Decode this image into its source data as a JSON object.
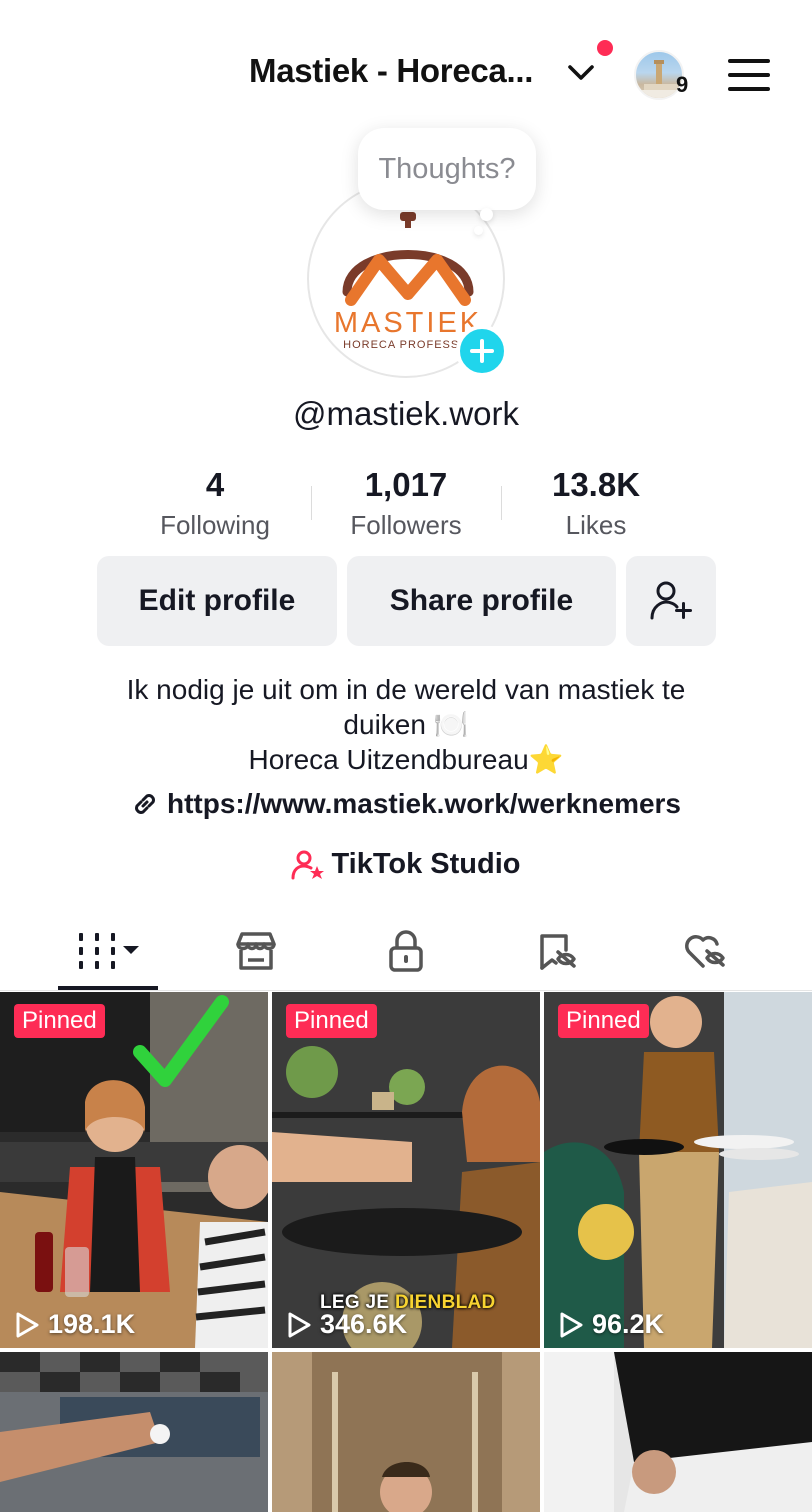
{
  "header": {
    "account_name": "Mastiek - Horeca...",
    "switch_account_count": "9"
  },
  "profile": {
    "thoughts_placeholder": "Thoughts?",
    "logo": {
      "brand": "MASTIEK",
      "tagline": "HORECA PROFESSIO"
    },
    "username": "@mastiek.work"
  },
  "stats": [
    {
      "value": "4",
      "label": "Following"
    },
    {
      "value": "1,017",
      "label": "Followers"
    },
    {
      "value": "13.8K",
      "label": "Likes"
    }
  ],
  "actions": {
    "edit_profile": "Edit profile",
    "share_profile": "Share profile"
  },
  "bio": {
    "line1": "Ik nodig je uit om in de wereld van mastiek te",
    "line2": "duiken 🍽️",
    "line3": "Horeca Uitzendbureau⭐",
    "link": "https://www.mastiek.work/werknemers",
    "studio": "TikTok Studio"
  },
  "tabs": [
    {
      "name": "videos",
      "icon": "grid-bars-icon",
      "active": true
    },
    {
      "name": "shop",
      "icon": "storefront-icon",
      "active": false
    },
    {
      "name": "private",
      "icon": "lock-icon",
      "active": false
    },
    {
      "name": "favorites",
      "icon": "bookmark-hidden-icon",
      "active": false
    },
    {
      "name": "liked",
      "icon": "heart-hidden-icon",
      "active": false
    }
  ],
  "videos": [
    {
      "pinned": "Pinned",
      "views": "198.1K"
    },
    {
      "pinned": "Pinned",
      "views": "346.6K",
      "caption_a": "LEG JE ",
      "caption_b": "DIENBLAD"
    },
    {
      "pinned": "Pinned",
      "views": "96.2K"
    },
    {
      "pinned": "",
      "views": ""
    },
    {
      "pinned": "",
      "views": ""
    },
    {
      "pinned": "",
      "views": ""
    }
  ],
  "colors": {
    "accent_red": "#fe2c55",
    "story_plus": "#20d5ec",
    "button_bg": "#eff0f2",
    "logo_orange": "#e8762d",
    "logo_brown": "#7a3b2a"
  }
}
